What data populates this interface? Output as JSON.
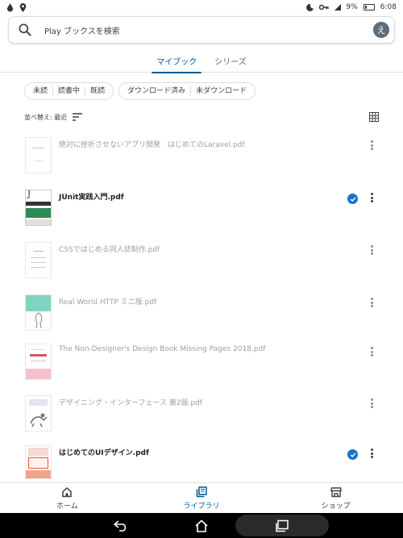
{
  "status": {
    "battery": "9%",
    "time": "6:08"
  },
  "search": {
    "placeholder": "Play ブックスを検索",
    "avatar_initial": "え"
  },
  "tabs": [
    {
      "label": "マイブック",
      "active": true
    },
    {
      "label": "シリーズ",
      "active": false
    }
  ],
  "filters": {
    "group1": [
      "未読",
      "読書中",
      "既読"
    ],
    "group2": [
      "ダウンロード済み",
      "未ダウンロード"
    ]
  },
  "sort": {
    "label": "並べ替え: 最近"
  },
  "books": [
    {
      "title": "絶対に挫折させないアプリ開発　はじめてのLaravel.pdf",
      "downloaded": false
    },
    {
      "title": "JUnit実践入門.pdf",
      "downloaded": true
    },
    {
      "title": "CSSではじめる同人誌制作.pdf",
      "downloaded": false
    },
    {
      "title": "Real World HTTP ミニ版.pdf",
      "downloaded": false
    },
    {
      "title": "The Non-Designer's Design Book Missing Pages 2018.pdf",
      "downloaded": false
    },
    {
      "title": "デザイニング・インターフェース 第2版.pdf",
      "downloaded": false
    },
    {
      "title": "はじめてのUIデザイン.pdf",
      "downloaded": true
    }
  ],
  "bottom_nav": [
    {
      "label": "ホーム",
      "icon": "home-icon",
      "active": false
    },
    {
      "label": "ライブラリ",
      "icon": "library-icon",
      "active": true
    },
    {
      "label": "ショップ",
      "icon": "shop-icon",
      "active": false
    }
  ],
  "colors": {
    "accent": "#01579b",
    "check": "#1a73c8"
  }
}
